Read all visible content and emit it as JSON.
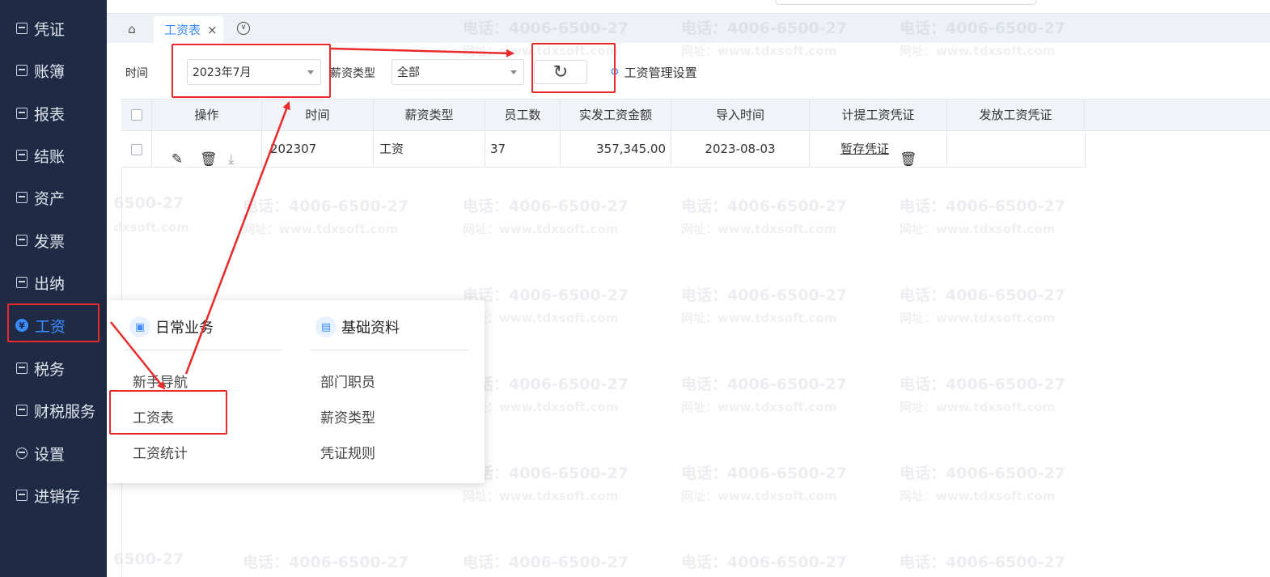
{
  "sidebar": {
    "items": [
      {
        "label": "凭证"
      },
      {
        "label": "账簿"
      },
      {
        "label": "报表"
      },
      {
        "label": "结账"
      },
      {
        "label": "资产"
      },
      {
        "label": "发票"
      },
      {
        "label": "出纳"
      },
      {
        "label": "工资",
        "active": true
      },
      {
        "label": "税务"
      },
      {
        "label": "财税服务"
      },
      {
        "label": "设置"
      },
      {
        "label": "进销存"
      }
    ]
  },
  "tabs": {
    "home_icon": "home-icon",
    "active_label": "工资表",
    "close_glyph": "×"
  },
  "filters": {
    "time_label": "时间",
    "time_value": "2023年7月",
    "salary_type_label": "薪资类型",
    "salary_type_value": "全部",
    "settings_label": "工资管理设置"
  },
  "table": {
    "headers": [
      "操作",
      "时间",
      "薪资类型",
      "员工数",
      "实发工资金额",
      "导入时间",
      "计提工资凭证",
      "发放工资凭证"
    ],
    "rows": [
      {
        "time": "202307",
        "salary_type": "工资",
        "employees": "37",
        "amount": "357,345.00",
        "import_time": "2023-08-03",
        "accrual_voucher": "暂存凭证",
        "payment_voucher": ""
      }
    ]
  },
  "menu": {
    "col1_title": "日常业务",
    "col1_items": [
      "新手导航",
      "工资表",
      "工资统计"
    ],
    "col2_title": "基础资料",
    "col2_items": [
      "部门职员",
      "薪资类型",
      "凭证规则"
    ]
  },
  "watermark": {
    "phone": "电话：4006-6500-27",
    "phone_partial": "6500-27",
    "site": "网址：www.tdxsoft.com",
    "site_partial": "dxsoft.com"
  },
  "colors": {
    "sidebar_bg": "#1f2a44",
    "accent": "#3b8cff",
    "annotation_red": "#ea2a2a"
  }
}
